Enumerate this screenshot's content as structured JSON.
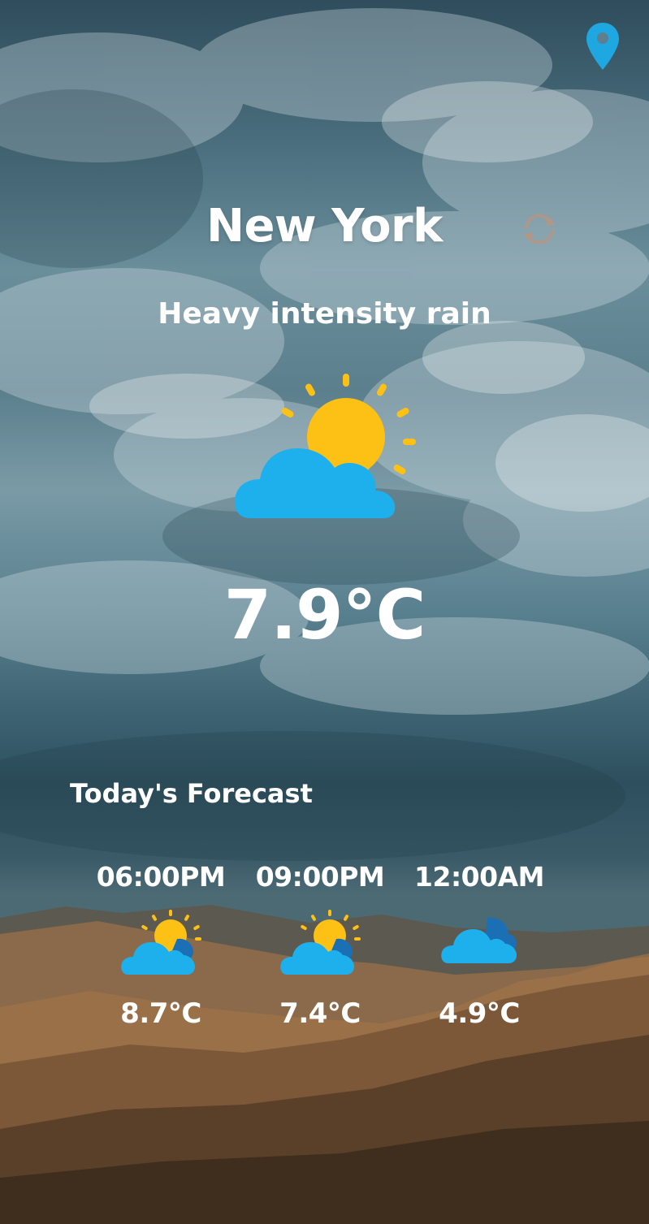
{
  "header": {
    "location_icon": "location-pin-icon",
    "refresh_icon": "refresh-icon"
  },
  "current": {
    "city": "New York",
    "description": "Heavy intensity rain",
    "icon": "partly-cloudy-icon",
    "temperature": "7.9°C"
  },
  "forecast": {
    "title": "Today's Forecast",
    "items": [
      {
        "time": "06:00PM",
        "icon": "partly-cloudy-icon",
        "temp": "8.7°C"
      },
      {
        "time": "09:00PM",
        "icon": "partly-cloudy-icon",
        "temp": "7.4°C"
      },
      {
        "time": "12:00AM",
        "icon": "cloudy-icon",
        "temp": "4.9°C"
      }
    ]
  },
  "colors": {
    "accent_blue": "#1EA7E1",
    "sun_yellow": "#FDC014",
    "text": "#FFFFFF"
  }
}
